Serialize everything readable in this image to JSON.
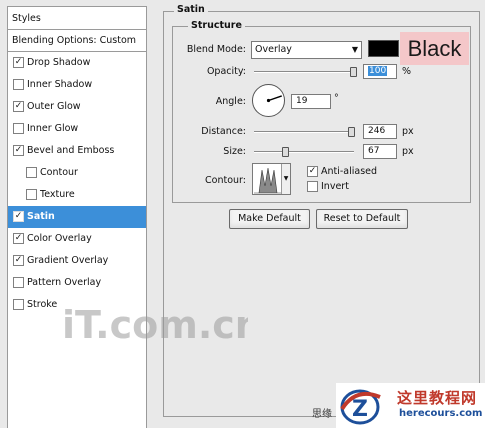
{
  "styles_panel": {
    "header": "Styles",
    "blending_options": "Blending Options: Custom",
    "items": [
      {
        "label": "Drop Shadow",
        "checked": true,
        "indent": false,
        "selected": false
      },
      {
        "label": "Inner Shadow",
        "checked": false,
        "indent": false,
        "selected": false
      },
      {
        "label": "Outer Glow",
        "checked": true,
        "indent": false,
        "selected": false
      },
      {
        "label": "Inner Glow",
        "checked": false,
        "indent": false,
        "selected": false
      },
      {
        "label": "Bevel and Emboss",
        "checked": true,
        "indent": false,
        "selected": false
      },
      {
        "label": "Contour",
        "checked": false,
        "indent": true,
        "selected": false
      },
      {
        "label": "Texture",
        "checked": false,
        "indent": true,
        "selected": false
      },
      {
        "label": "Satin",
        "checked": true,
        "indent": false,
        "selected": true
      },
      {
        "label": "Color Overlay",
        "checked": true,
        "indent": false,
        "selected": false
      },
      {
        "label": "Gradient Overlay",
        "checked": true,
        "indent": false,
        "selected": false
      },
      {
        "label": "Pattern Overlay",
        "checked": false,
        "indent": false,
        "selected": false
      },
      {
        "label": "Stroke",
        "checked": false,
        "indent": false,
        "selected": false
      }
    ]
  },
  "satin": {
    "title": "Satin",
    "structure_title": "Structure",
    "blend_mode_label": "Blend Mode:",
    "blend_mode_value": "Overlay",
    "color_hex": "#000000",
    "color_annotation": "Black",
    "opacity_label": "Opacity:",
    "opacity_value": "100",
    "opacity_unit": "%",
    "angle_label": "Angle:",
    "angle_value": "19",
    "angle_unit": "°",
    "distance_label": "Distance:",
    "distance_value": "246",
    "distance_unit": "px",
    "size_label": "Size:",
    "size_value": "67",
    "size_unit": "px",
    "contour_label": "Contour:",
    "anti_aliased_label": "Anti-aliased",
    "anti_aliased_checked": true,
    "invert_label": "Invert",
    "invert_checked": false
  },
  "buttons": {
    "make_default": "Make Default",
    "reset_default": "Reset to Default"
  },
  "watermarks": {
    "itcom": "iT.com.cn",
    "cn_text": "思缘",
    "site_title": "这里教程网",
    "site_url": "herecours.com"
  },
  "colors": {
    "selection": "#3c8fd9",
    "annotation_bg": "#f4c7c9",
    "opacity_highlight": "#3c8fd9"
  }
}
